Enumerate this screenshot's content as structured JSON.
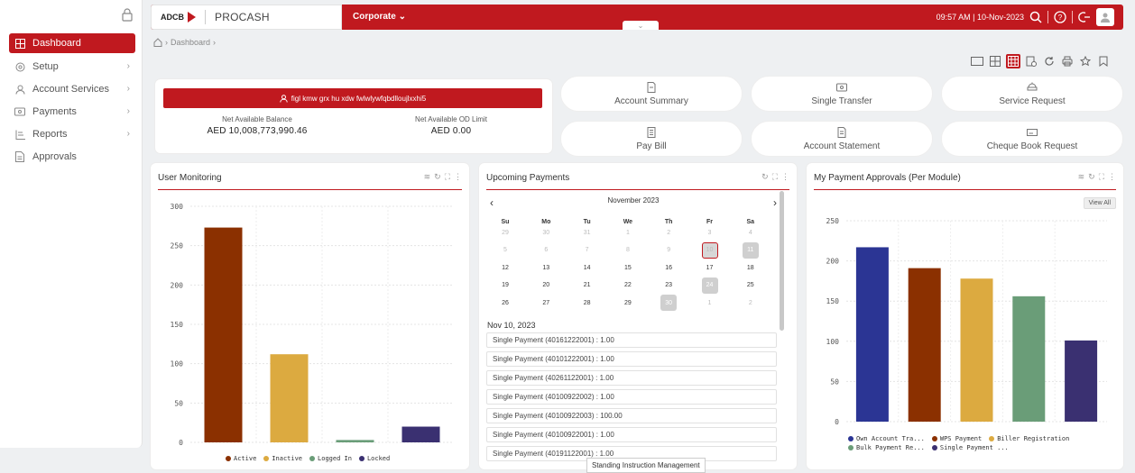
{
  "sidebar": {
    "items": [
      {
        "label": "Dashboard",
        "icon": "grid-icon",
        "active": true
      },
      {
        "label": "Setup",
        "icon": "gear-icon",
        "chevron": true
      },
      {
        "label": "Account Services",
        "icon": "user-icon",
        "chevron": true
      },
      {
        "label": "Payments",
        "icon": "card-icon",
        "chevron": true
      },
      {
        "label": "Reports",
        "icon": "report-icon",
        "chevron": true
      },
      {
        "label": "Approvals",
        "icon": "document-icon"
      }
    ]
  },
  "header": {
    "bank": "ADCB",
    "app_name": "PROCASH",
    "corporate_label": "Corporate",
    "datetime": "09:57 AM | 10-Nov-2023"
  },
  "breadcrumb": {
    "current": "Dashboard"
  },
  "balance": {
    "account": "figl kmw grx hu xdw fwlwlywfqbdlloujlxxhi5",
    "net_balance_label": "Net Available Balance",
    "net_balance_value": "AED 10,008,773,990.46",
    "od_limit_label": "Net Available OD Limit",
    "od_limit_value": "AED 0.00"
  },
  "tiles": [
    "Account Summary",
    "Single Transfer",
    "Service Request",
    "Pay Bill",
    "Account Statement",
    "Cheque Book Request"
  ],
  "user_monitoring": {
    "title": "User Monitoring",
    "chart_data": {
      "type": "bar",
      "categories": [
        "Active",
        "Inactive",
        "Logged In",
        "Locked"
      ],
      "values": [
        273,
        112,
        3,
        20
      ],
      "colors": [
        "#8b3000",
        "#dcaa40",
        "#6a9d78",
        "#3a3071"
      ],
      "ylim": [
        0,
        300
      ],
      "yticks": [
        0,
        50,
        100,
        150,
        200,
        250,
        300
      ],
      "legend": [
        "Active",
        "Inactive",
        "Logged In",
        "Locked"
      ]
    }
  },
  "upcoming_payments": {
    "title": "Upcoming Payments",
    "month_label": "November 2023",
    "weekdays": [
      "Su",
      "Mo",
      "Tu",
      "We",
      "Th",
      "Fr",
      "Sa"
    ],
    "weeks": [
      [
        "29",
        "30",
        "31",
        "1",
        "2",
        "3",
        "4"
      ],
      [
        "5",
        "6",
        "7",
        "8",
        "9",
        "10",
        "11"
      ],
      [
        "12",
        "13",
        "14",
        "15",
        "16",
        "17",
        "18"
      ],
      [
        "19",
        "20",
        "21",
        "22",
        "23",
        "24",
        "25"
      ],
      [
        "26",
        "27",
        "28",
        "29",
        "30",
        "1",
        "2"
      ]
    ],
    "selected_date_label": "Nov 10, 2023",
    "payments": [
      "Single Payment (40161222001) : 1.00",
      "Single Payment (40101222001) : 1.00",
      "Single Payment (40261122001) : 1.00",
      "Single Payment (40100922002) : 1.00",
      "Single Payment (40100922003) : 100.00",
      "Single Payment (40100922001) : 1.00",
      "Single Payment (40191122001) : 1.00"
    ],
    "tooltip": "Standing Instruction Management"
  },
  "approvals": {
    "title": "My Payment Approvals (Per Module)",
    "view_all": "View All",
    "chart_data": {
      "type": "bar",
      "categories": [
        "Own Account Tra...",
        "WPS Payment",
        "Biller Registration",
        "Bulk Payment Re...",
        "Single Payment ..."
      ],
      "values": [
        217,
        191,
        178,
        156,
        101
      ],
      "colors": [
        "#2b3594",
        "#8b3000",
        "#dcaa40",
        "#6a9d78",
        "#3a3071"
      ],
      "ylim": [
        0,
        250
      ],
      "yticks": [
        0,
        50,
        100,
        150,
        200,
        250
      ],
      "legend": [
        "Own Account Tra...",
        "WPS Payment",
        "Biller Registration",
        "Bulk Payment Re...",
        "Single Payment ..."
      ]
    }
  }
}
